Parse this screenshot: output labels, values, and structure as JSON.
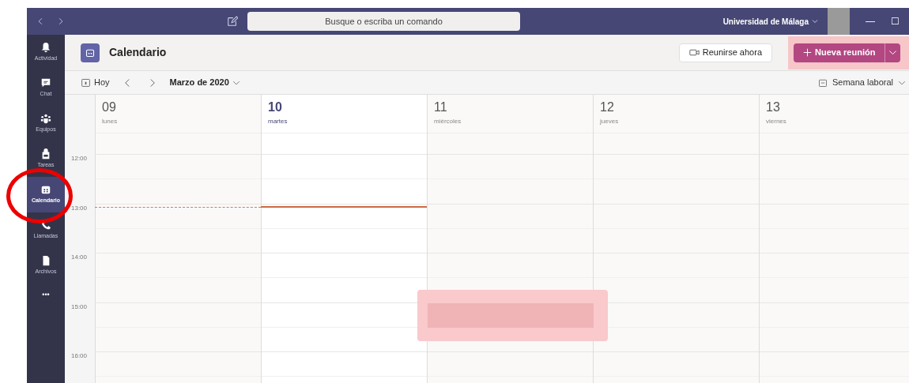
{
  "title_bar": {
    "search": {
      "placeholder": "Busque o escriba un comando"
    },
    "organization": "Universidad de Málaga",
    "window_controls": [
      "—",
      "☐"
    ]
  },
  "sidebar": {
    "items": [
      {
        "label": "Actividad",
        "selected": false
      },
      {
        "label": "Chat",
        "selected": false
      },
      {
        "label": "Equipos",
        "selected": false
      },
      {
        "label": "Tareas",
        "selected": false
      },
      {
        "label": "Calendario",
        "selected": true
      },
      {
        "label": "Llamadas",
        "selected": false
      },
      {
        "label": "Archivos",
        "selected": false
      }
    ],
    "more": "•••"
  },
  "header": {
    "title": "Calendario",
    "meet_now": "Reunirse ahora",
    "new_meeting": "Nueva reunión"
  },
  "toolbar": {
    "today": "Hoy",
    "month": "Marzo de 2020",
    "view": "Semana laboral"
  },
  "days": [
    {
      "number": "09",
      "weekday": "lunes",
      "selected": false
    },
    {
      "number": "10",
      "weekday": "martes",
      "selected": true
    },
    {
      "number": "11",
      "weekday": "miércoles",
      "selected": false
    },
    {
      "number": "12",
      "weekday": "jueves",
      "selected": false
    },
    {
      "number": "13",
      "weekday": "viernes",
      "selected": false
    }
  ],
  "hours": [
    "12:00",
    "13:00",
    "14:00",
    "15:00",
    "16:00"
  ]
}
